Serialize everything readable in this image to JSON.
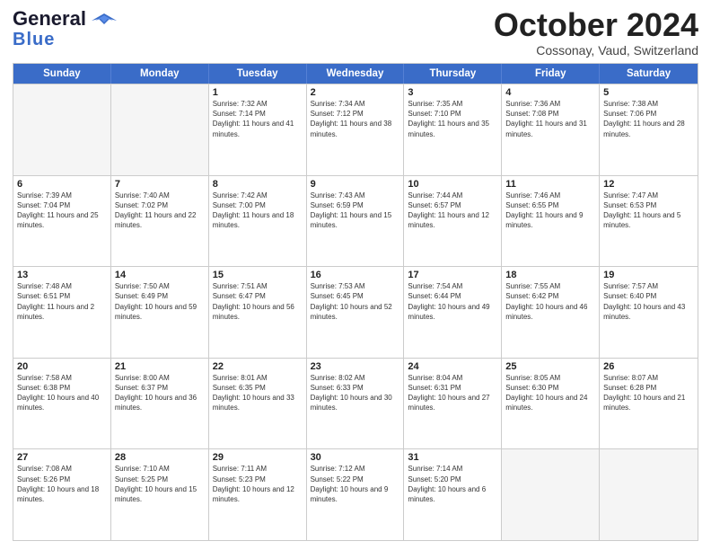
{
  "header": {
    "logo_general": "General",
    "logo_blue": "Blue",
    "month_title": "October 2024",
    "location": "Cossonay, Vaud, Switzerland"
  },
  "days_of_week": [
    "Sunday",
    "Monday",
    "Tuesday",
    "Wednesday",
    "Thursday",
    "Friday",
    "Saturday"
  ],
  "weeks": [
    [
      {
        "day": "",
        "empty": true
      },
      {
        "day": "",
        "empty": true
      },
      {
        "day": "1",
        "sunrise": "Sunrise: 7:32 AM",
        "sunset": "Sunset: 7:14 PM",
        "daylight": "Daylight: 11 hours and 41 minutes."
      },
      {
        "day": "2",
        "sunrise": "Sunrise: 7:34 AM",
        "sunset": "Sunset: 7:12 PM",
        "daylight": "Daylight: 11 hours and 38 minutes."
      },
      {
        "day": "3",
        "sunrise": "Sunrise: 7:35 AM",
        "sunset": "Sunset: 7:10 PM",
        "daylight": "Daylight: 11 hours and 35 minutes."
      },
      {
        "day": "4",
        "sunrise": "Sunrise: 7:36 AM",
        "sunset": "Sunset: 7:08 PM",
        "daylight": "Daylight: 11 hours and 31 minutes."
      },
      {
        "day": "5",
        "sunrise": "Sunrise: 7:38 AM",
        "sunset": "Sunset: 7:06 PM",
        "daylight": "Daylight: 11 hours and 28 minutes."
      }
    ],
    [
      {
        "day": "6",
        "sunrise": "Sunrise: 7:39 AM",
        "sunset": "Sunset: 7:04 PM",
        "daylight": "Daylight: 11 hours and 25 minutes."
      },
      {
        "day": "7",
        "sunrise": "Sunrise: 7:40 AM",
        "sunset": "Sunset: 7:02 PM",
        "daylight": "Daylight: 11 hours and 22 minutes."
      },
      {
        "day": "8",
        "sunrise": "Sunrise: 7:42 AM",
        "sunset": "Sunset: 7:00 PM",
        "daylight": "Daylight: 11 hours and 18 minutes."
      },
      {
        "day": "9",
        "sunrise": "Sunrise: 7:43 AM",
        "sunset": "Sunset: 6:59 PM",
        "daylight": "Daylight: 11 hours and 15 minutes."
      },
      {
        "day": "10",
        "sunrise": "Sunrise: 7:44 AM",
        "sunset": "Sunset: 6:57 PM",
        "daylight": "Daylight: 11 hours and 12 minutes."
      },
      {
        "day": "11",
        "sunrise": "Sunrise: 7:46 AM",
        "sunset": "Sunset: 6:55 PM",
        "daylight": "Daylight: 11 hours and 9 minutes."
      },
      {
        "day": "12",
        "sunrise": "Sunrise: 7:47 AM",
        "sunset": "Sunset: 6:53 PM",
        "daylight": "Daylight: 11 hours and 5 minutes."
      }
    ],
    [
      {
        "day": "13",
        "sunrise": "Sunrise: 7:48 AM",
        "sunset": "Sunset: 6:51 PM",
        "daylight": "Daylight: 11 hours and 2 minutes."
      },
      {
        "day": "14",
        "sunrise": "Sunrise: 7:50 AM",
        "sunset": "Sunset: 6:49 PM",
        "daylight": "Daylight: 10 hours and 59 minutes."
      },
      {
        "day": "15",
        "sunrise": "Sunrise: 7:51 AM",
        "sunset": "Sunset: 6:47 PM",
        "daylight": "Daylight: 10 hours and 56 minutes."
      },
      {
        "day": "16",
        "sunrise": "Sunrise: 7:53 AM",
        "sunset": "Sunset: 6:45 PM",
        "daylight": "Daylight: 10 hours and 52 minutes."
      },
      {
        "day": "17",
        "sunrise": "Sunrise: 7:54 AM",
        "sunset": "Sunset: 6:44 PM",
        "daylight": "Daylight: 10 hours and 49 minutes."
      },
      {
        "day": "18",
        "sunrise": "Sunrise: 7:55 AM",
        "sunset": "Sunset: 6:42 PM",
        "daylight": "Daylight: 10 hours and 46 minutes."
      },
      {
        "day": "19",
        "sunrise": "Sunrise: 7:57 AM",
        "sunset": "Sunset: 6:40 PM",
        "daylight": "Daylight: 10 hours and 43 minutes."
      }
    ],
    [
      {
        "day": "20",
        "sunrise": "Sunrise: 7:58 AM",
        "sunset": "Sunset: 6:38 PM",
        "daylight": "Daylight: 10 hours and 40 minutes."
      },
      {
        "day": "21",
        "sunrise": "Sunrise: 8:00 AM",
        "sunset": "Sunset: 6:37 PM",
        "daylight": "Daylight: 10 hours and 36 minutes."
      },
      {
        "day": "22",
        "sunrise": "Sunrise: 8:01 AM",
        "sunset": "Sunset: 6:35 PM",
        "daylight": "Daylight: 10 hours and 33 minutes."
      },
      {
        "day": "23",
        "sunrise": "Sunrise: 8:02 AM",
        "sunset": "Sunset: 6:33 PM",
        "daylight": "Daylight: 10 hours and 30 minutes."
      },
      {
        "day": "24",
        "sunrise": "Sunrise: 8:04 AM",
        "sunset": "Sunset: 6:31 PM",
        "daylight": "Daylight: 10 hours and 27 minutes."
      },
      {
        "day": "25",
        "sunrise": "Sunrise: 8:05 AM",
        "sunset": "Sunset: 6:30 PM",
        "daylight": "Daylight: 10 hours and 24 minutes."
      },
      {
        "day": "26",
        "sunrise": "Sunrise: 8:07 AM",
        "sunset": "Sunset: 6:28 PM",
        "daylight": "Daylight: 10 hours and 21 minutes."
      }
    ],
    [
      {
        "day": "27",
        "sunrise": "Sunrise: 7:08 AM",
        "sunset": "Sunset: 5:26 PM",
        "daylight": "Daylight: 10 hours and 18 minutes."
      },
      {
        "day": "28",
        "sunrise": "Sunrise: 7:10 AM",
        "sunset": "Sunset: 5:25 PM",
        "daylight": "Daylight: 10 hours and 15 minutes."
      },
      {
        "day": "29",
        "sunrise": "Sunrise: 7:11 AM",
        "sunset": "Sunset: 5:23 PM",
        "daylight": "Daylight: 10 hours and 12 minutes."
      },
      {
        "day": "30",
        "sunrise": "Sunrise: 7:12 AM",
        "sunset": "Sunset: 5:22 PM",
        "daylight": "Daylight: 10 hours and 9 minutes."
      },
      {
        "day": "31",
        "sunrise": "Sunrise: 7:14 AM",
        "sunset": "Sunset: 5:20 PM",
        "daylight": "Daylight: 10 hours and 6 minutes."
      },
      {
        "day": "",
        "empty": true
      },
      {
        "day": "",
        "empty": true
      }
    ]
  ]
}
